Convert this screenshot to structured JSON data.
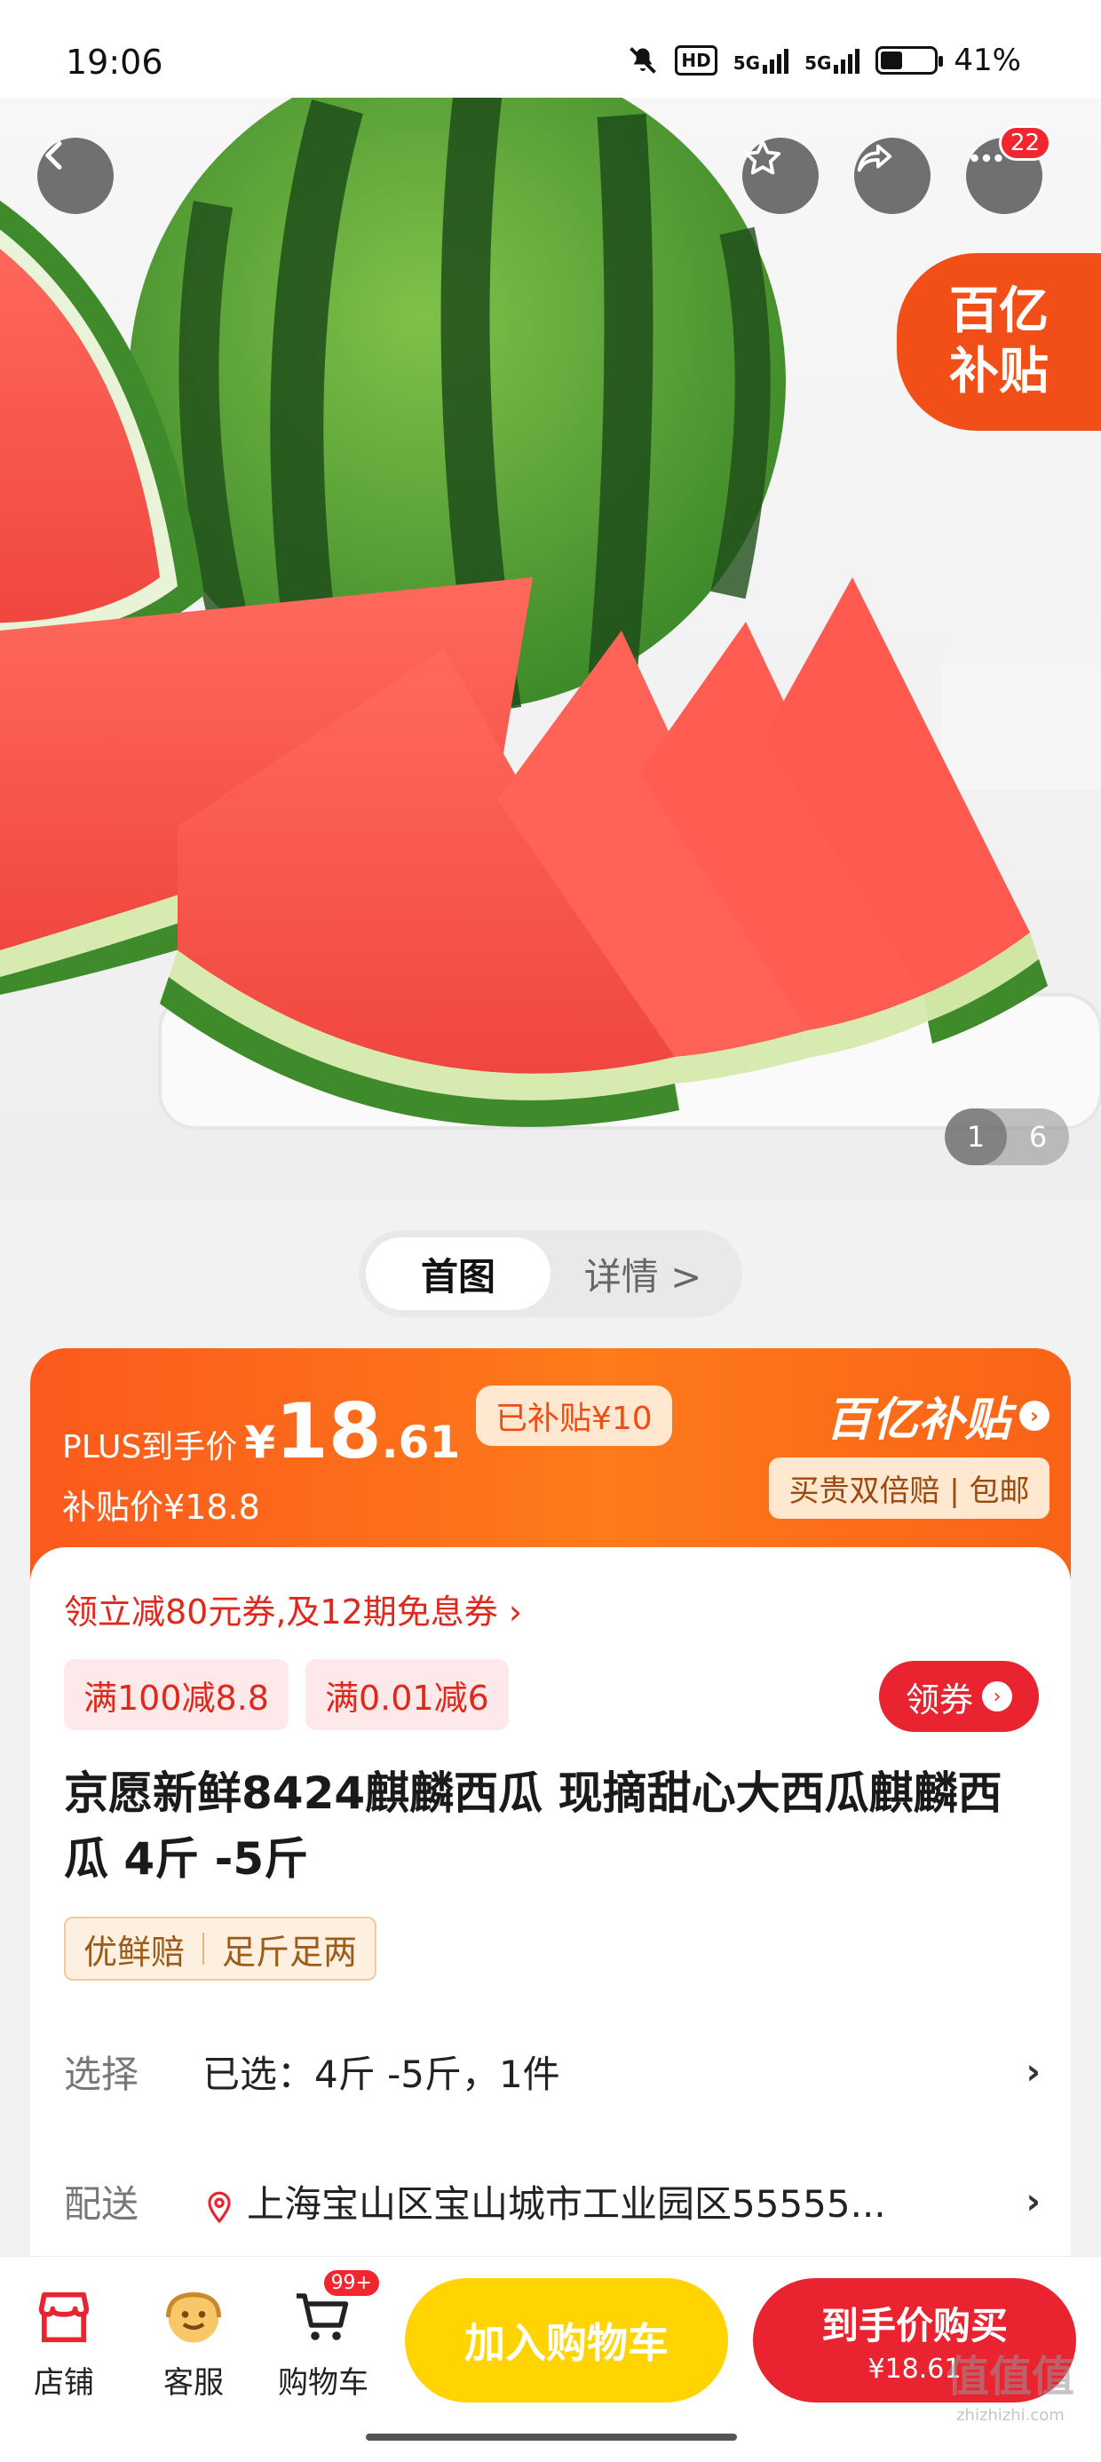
{
  "status_bar": {
    "time": "19:06",
    "network_1": "5G",
    "network_2": "5G",
    "hd": "HD",
    "battery": "41%",
    "battery_level": 0.41
  },
  "hero": {
    "favorite_icon": "star-icon",
    "share_icon": "share-icon",
    "more_icon": "more-icon",
    "more_badge": "22",
    "subsidy_tag_line1": "百亿",
    "subsidy_tag_line2": "补贴",
    "pager_current": "1",
    "pager_total": "6"
  },
  "tabs": [
    {
      "label": "首图"
    },
    {
      "label": "详情 >"
    }
  ],
  "price": {
    "plus_label": "PLUS到手价",
    "currency": "¥",
    "integer": "18",
    "decimal": ".61",
    "subsidized_pill": "已补贴¥10",
    "sub_price": "补贴价¥18.8",
    "brand": "百亿补贴",
    "brand_arrow": "›",
    "brand_sub": "买贵双倍赔 | 包邮"
  },
  "coupon": {
    "line": "领立减80元券,及12期免息券 ›",
    "chips": [
      "满100减8.8",
      "满0.01减6"
    ],
    "button": "领券",
    "button_arrow": "›"
  },
  "product": {
    "title": "京愿新鲜8424麒麟西瓜 现摘甜心大西瓜麒麟西瓜 4斤 -5斤",
    "guarantees": [
      "优鲜赔",
      "足斤足两"
    ]
  },
  "rows": {
    "select_label": "选择",
    "select_value": "已选：4斤 -5斤，1件",
    "delivery_label": "配送",
    "delivery_value": "上海宝山区宝山城市工业园区55555...",
    "chevron": "›"
  },
  "bottom_bar": {
    "store": "店铺",
    "service": "客服",
    "cart": "购物车",
    "cart_badge": "99+",
    "add_to_cart": "加入购物车",
    "buy_now": "到手价购买",
    "buy_price": "¥18.61"
  },
  "watermark": {
    "text": "值",
    "sub": "zhizhizhi.com"
  },
  "colors": {
    "primary_red": "#ea2330",
    "orange": "#fb5a1c",
    "yellow": "#ffd400"
  }
}
